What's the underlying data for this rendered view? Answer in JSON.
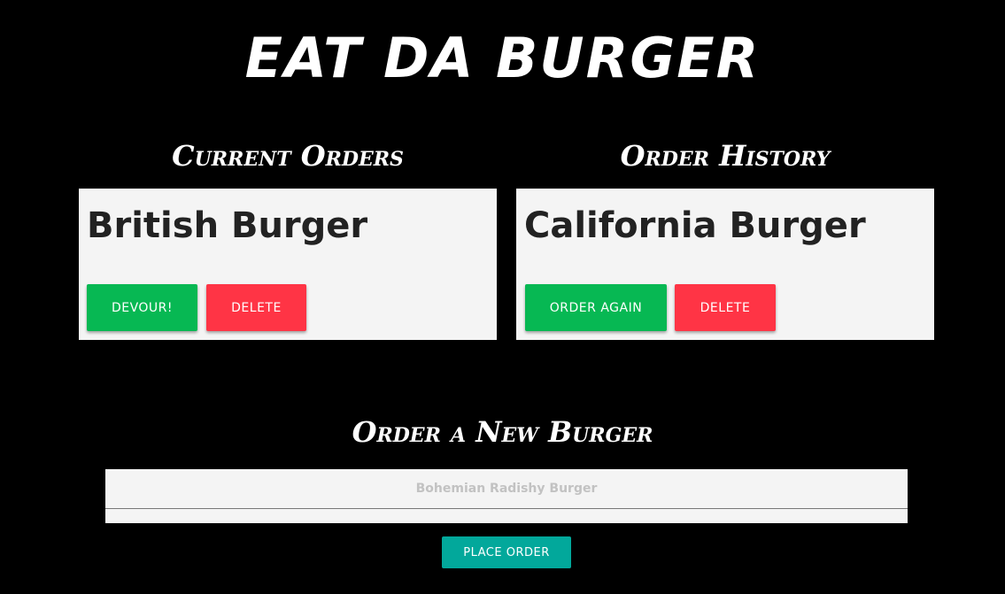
{
  "header": {
    "title": "EAT DA BURGER"
  },
  "current_orders": {
    "title": "Current Orders",
    "burger": {
      "name": "British Burger",
      "devour_label": "DEVOUR!",
      "delete_label": "DELETE"
    }
  },
  "order_history": {
    "title": "Order History",
    "burger": {
      "name": "California Burger",
      "order_again_label": "ORDER AGAIN",
      "delete_label": "DELETE"
    }
  },
  "new_order": {
    "title": "Order a New Burger",
    "input_placeholder": "Bohemian Radishy Burger",
    "input_value": "",
    "submit_label": "PLACE ORDER"
  },
  "colors": {
    "background": "#000000",
    "card": "#f4f4f4",
    "green": "#07b853",
    "red": "#ff3445",
    "teal": "#02a89b"
  }
}
